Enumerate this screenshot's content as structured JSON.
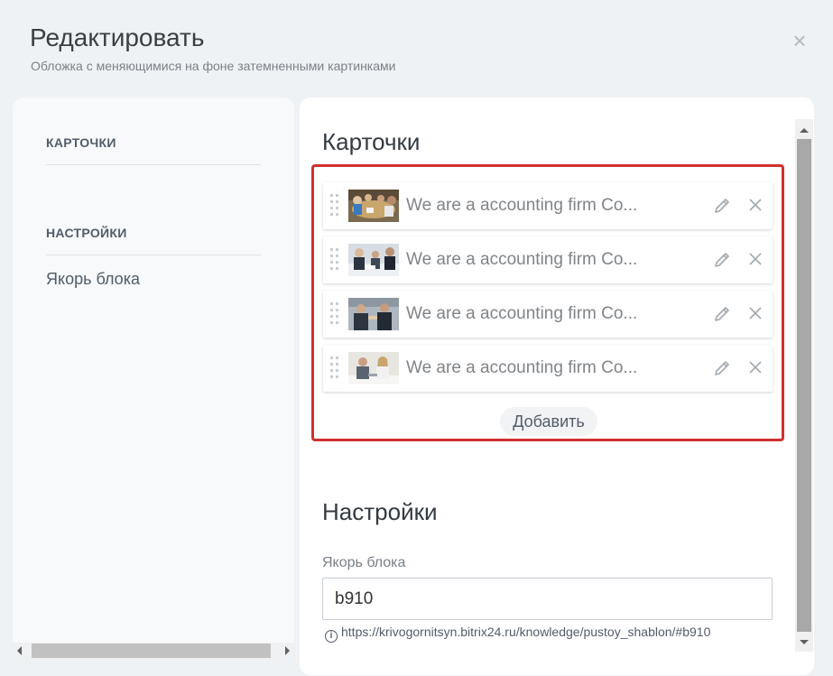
{
  "header": {
    "title": "Редактировать",
    "subtitle": "Обложка с меняющимися на фоне затемненными картинками",
    "close_icon": "×"
  },
  "sidebar": {
    "sections": [
      {
        "heading": "КАРТОЧКИ",
        "items": []
      },
      {
        "heading": "НАСТРОЙКИ",
        "items": [
          {
            "label": "Якорь блока"
          }
        ]
      }
    ]
  },
  "main": {
    "cards_section": {
      "title": "Карточки",
      "cards": [
        {
          "title": "We are a accounting firm Co...",
          "thumbnail": "office-meeting-photo"
        },
        {
          "title": "We are a accounting firm Co...",
          "thumbnail": "business-team-photo"
        },
        {
          "title": "We are a accounting firm Co...",
          "thumbnail": "handshake-photo"
        },
        {
          "title": "We are a accounting firm Co...",
          "thumbnail": "colleagues-photo"
        }
      ],
      "add_label": "Добавить",
      "highlight_color": "#d0312d"
    },
    "settings_section": {
      "title": "Настройки",
      "anchor_label": "Якорь блока",
      "anchor_value": "b910",
      "anchor_hint": "https://krivogornitsyn.bitrix24.ru/knowledge/pustoy_shablon/#b910",
      "hint_icon": "i"
    }
  }
}
